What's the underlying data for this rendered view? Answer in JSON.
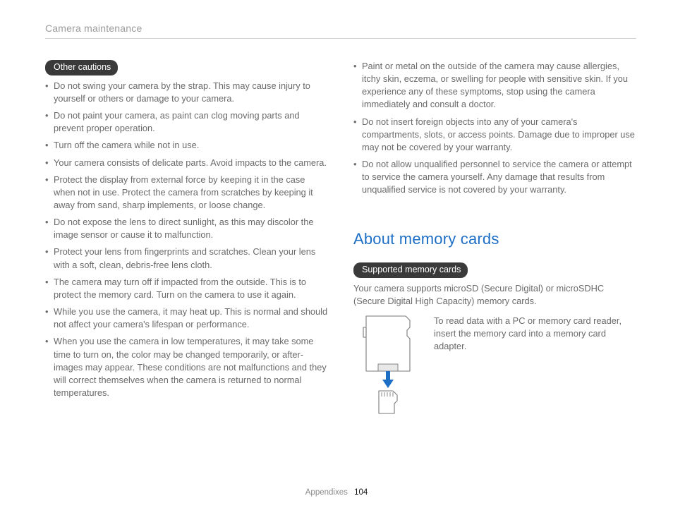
{
  "header": {
    "title": "Camera maintenance"
  },
  "leftColumn": {
    "pill": "Other cautions",
    "bullets": [
      "Do not swing your camera by the strap. This may cause injury to yourself or others or damage to your camera.",
      "Do not paint your camera, as paint can clog moving parts and prevent proper operation.",
      "Turn off the camera while not in use.",
      "Your camera consists of delicate parts. Avoid impacts to the camera.",
      "Protect the display from external force by keeping it in the case when not in use. Protect the camera from scratches by keeping it away from sand, sharp implements, or loose change.",
      "Do not expose the lens to direct sunlight, as this may discolor the image sensor or cause it to malfunction.",
      "Protect your lens from fingerprints and scratches. Clean your lens with a soft, clean, debris-free lens cloth.",
      "The camera may turn off if impacted from the outside. This is to protect the memory card. Turn on the camera to use it again.",
      "While you use the camera, it may heat up. This is normal and should not affect your camera's lifespan or performance.",
      "When you use the camera in low temperatures, it may take some time to turn on, the color may be changed temporarily, or after-images may appear. These conditions are not malfunctions and they will correct themselves when the camera is returned to normal temperatures."
    ]
  },
  "rightColumn": {
    "continuedBullets": [
      "Paint or metal on the outside of the camera may cause allergies, itchy skin, eczema, or swelling for people with sensitive skin. If you experience any of these symptoms, stop using the camera immediately and consult a doctor.",
      "Do not insert foreign objects into any of your camera's compartments, slots, or access points. Damage due to improper use may not be covered by your warranty.",
      "Do not allow unqualified personnel to service the camera or attempt to service the camera yourself. Any damage that results from unqualified service is not covered by your warranty."
    ],
    "sectionTitle": "About memory cards",
    "pill2": "Supported memory cards",
    "intro": "Your camera supports microSD (Secure Digital) or microSDHC (Secure Digital High Capacity) memory cards.",
    "adapterNote": "To read data with a PC or memory card reader, insert the memory card into a memory card adapter."
  },
  "footer": {
    "section": "Appendixes",
    "page": "104"
  }
}
